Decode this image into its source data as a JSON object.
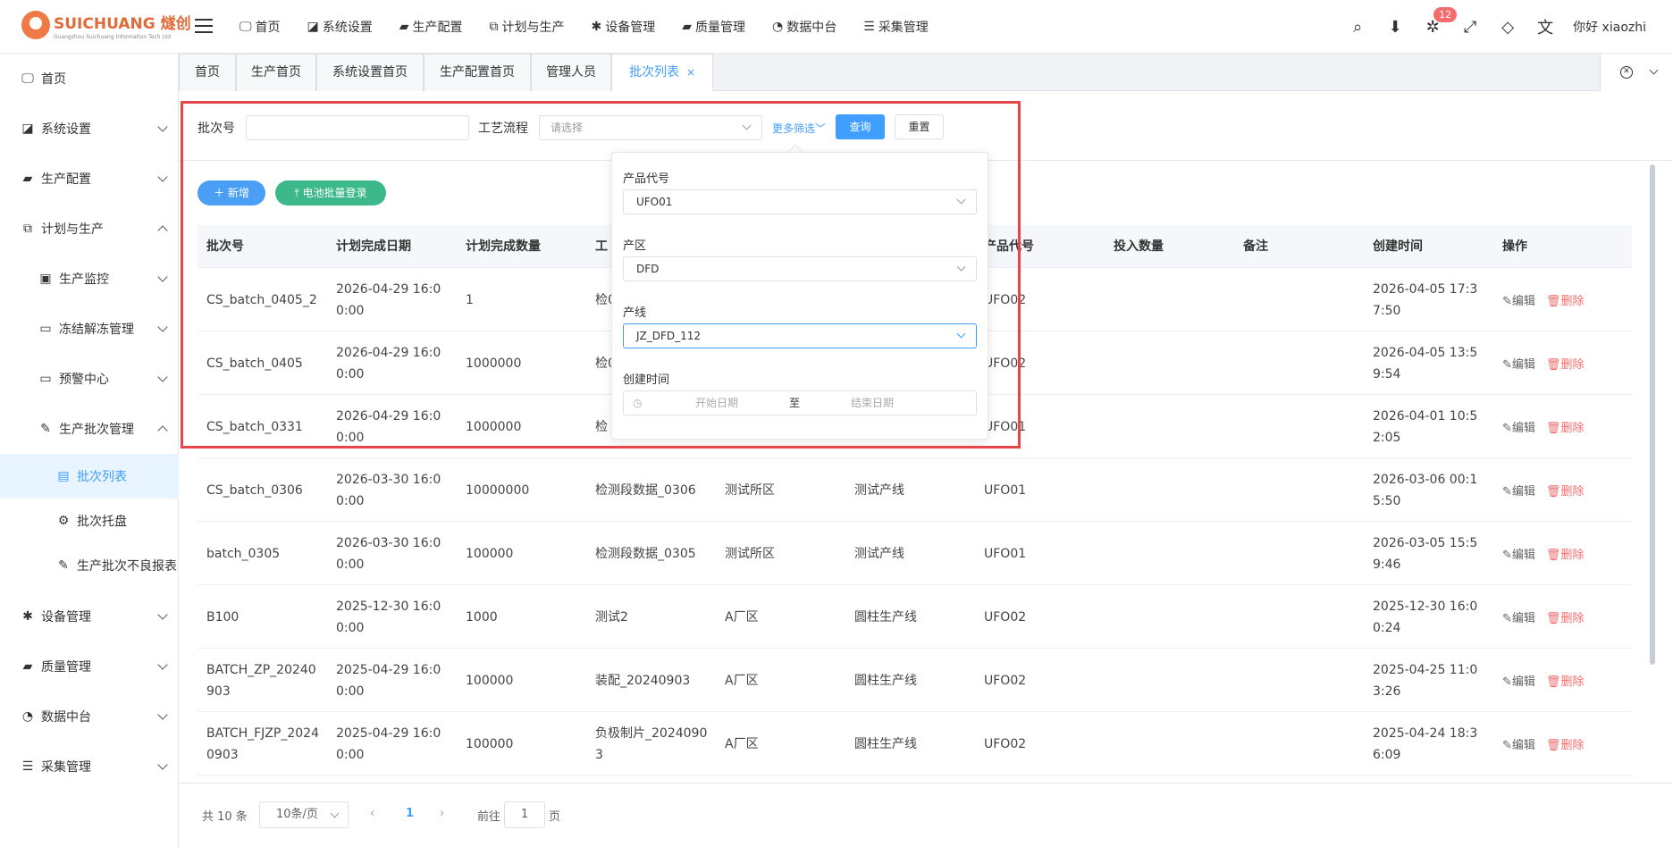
{
  "brand": {
    "logo_text": "SUICHUANG 燧创",
    "logo_sub": "Guangzhou Suichuang Information Tech Ltd"
  },
  "topnav": [
    {
      "icon": "monitor-icon",
      "glyph": "🖵",
      "label": "首页"
    },
    {
      "icon": "badge-icon",
      "glyph": "◪",
      "label": "系统设置"
    },
    {
      "icon": "briefcase-icon",
      "glyph": "▰",
      "label": "生产配置"
    },
    {
      "icon": "windows-icon",
      "glyph": "⧉",
      "label": "计划与生产"
    },
    {
      "icon": "asterisk-icon",
      "glyph": "✱",
      "label": "设备管理"
    },
    {
      "icon": "briefcase-icon",
      "glyph": "▰",
      "label": "质量管理"
    },
    {
      "icon": "pie-chart-icon",
      "glyph": "◔",
      "label": "数据中台"
    },
    {
      "icon": "database-icon",
      "glyph": "☰",
      "label": "采集管理"
    }
  ],
  "header_right": {
    "badge_count": "12",
    "greeting": "你好 xiaozhi"
  },
  "sidebar": [
    {
      "label": "首页",
      "glyph": "🖵",
      "level": 1,
      "arrow": "",
      "name": "sidebar-item-home"
    },
    {
      "label": "系统设置",
      "glyph": "◪",
      "level": 1,
      "arrow": "down",
      "name": "sidebar-item-system-settings"
    },
    {
      "label": "生产配置",
      "glyph": "▰",
      "level": 1,
      "arrow": "down",
      "name": "sidebar-item-production-config"
    },
    {
      "label": "计划与生产",
      "glyph": "⧉",
      "level": 1,
      "arrow": "up",
      "name": "sidebar-item-planning"
    },
    {
      "label": "生产监控",
      "glyph": "▣",
      "level": 2,
      "arrow": "down",
      "name": "sidebar-item-monitoring"
    },
    {
      "label": "冻结解冻管理",
      "glyph": "▭",
      "level": 2,
      "arrow": "down",
      "name": "sidebar-item-freeze"
    },
    {
      "label": "预警中心",
      "glyph": "▭",
      "level": 2,
      "arrow": "down",
      "name": "sidebar-item-warning"
    },
    {
      "label": "生产批次管理",
      "glyph": "✎",
      "level": 2,
      "arrow": "up",
      "name": "sidebar-item-batch-mgmt"
    },
    {
      "label": "批次列表",
      "glyph": "▤",
      "level": 3,
      "arrow": "",
      "name": "sidebar-item-batch-list",
      "active": true
    },
    {
      "label": "批次托盘",
      "glyph": "⚙",
      "level": 3,
      "arrow": "",
      "name": "sidebar-item-batch-tray"
    },
    {
      "label": "生产批次不良报表",
      "glyph": "✎",
      "level": 3,
      "arrow": "",
      "name": "sidebar-item-defect-report"
    },
    {
      "label": "设备管理",
      "glyph": "✱",
      "level": 1,
      "arrow": "down",
      "name": "sidebar-item-equipment"
    },
    {
      "label": "质量管理",
      "glyph": "▰",
      "level": 1,
      "arrow": "down",
      "name": "sidebar-item-quality"
    },
    {
      "label": "数据中台",
      "glyph": "◔",
      "level": 1,
      "arrow": "down",
      "name": "sidebar-item-data-center"
    },
    {
      "label": "采集管理",
      "glyph": "☰",
      "level": 1,
      "arrow": "down",
      "name": "sidebar-item-collection"
    }
  ],
  "tabs": [
    {
      "label": "首页"
    },
    {
      "label": "生产首页"
    },
    {
      "label": "系统设置首页"
    },
    {
      "label": "生产配置首页"
    },
    {
      "label": "管理人员"
    },
    {
      "label": "批次列表",
      "active": true,
      "close": "×"
    }
  ],
  "search": {
    "batch_label": "批次号",
    "batch_value": "",
    "process_label": "工艺流程",
    "process_placeholder": "请选择",
    "more_filters": "更多筛选",
    "query_btn": "查询",
    "reset_btn": "重置"
  },
  "actions": {
    "add_btn": "新增",
    "battery_btn": "电池批量登录"
  },
  "filter_popover": {
    "product_code_label": "产品代号",
    "product_code_value": "UFO01",
    "area_label": "产区",
    "area_value": "DFD",
    "line_label": "产线",
    "line_value": "JZ_DFD_112",
    "created_label": "创建时间",
    "start_placeholder": "开始日期",
    "range_sep": "至",
    "end_placeholder": "结束日期"
  },
  "table": {
    "columns": [
      "批次号",
      "计划完成日期",
      "计划完成数量",
      "工",
      "",
      "",
      "产品代号",
      "投入数量",
      "备注",
      "创建时间",
      "操作"
    ],
    "rows": [
      [
        "CS_batch_0405_2",
        "2026-04-29 16:00:00",
        "1",
        "检0",
        "",
        "",
        "UFO02",
        "",
        "",
        "2026-04-05 17:37:50"
      ],
      [
        "CS_batch_0405",
        "2026-04-29 16:00:00",
        "1000000",
        "检0",
        "",
        "",
        "UFO02",
        "",
        "",
        "2026-04-05 13:59:54"
      ],
      [
        "CS_batch_0331",
        "2026-04-29 16:00:00",
        "1000000",
        "检",
        "",
        "",
        "UFO01",
        "",
        "",
        "2026-04-01 10:52:05"
      ],
      [
        "CS_batch_0306",
        "2026-03-30 16:00:00",
        "10000000",
        "检测段数据_0306",
        "测试所区",
        "测试产线",
        "UFO01",
        "",
        "",
        "2026-03-06 00:15:50"
      ],
      [
        "batch_0305",
        "2026-03-30 16:00:00",
        "100000",
        "检测段数据_0305",
        "测试所区",
        "测试产线",
        "UFO01",
        "",
        "",
        "2026-03-05 15:59:46"
      ],
      [
        "B100",
        "2025-12-30 16:00:00",
        "1000",
        "测试2",
        "A厂区",
        "圆柱生产线",
        "UFO02",
        "",
        "",
        "2025-12-30 16:00:24"
      ],
      [
        "BATCH_ZP_20240903",
        "2025-04-29 16:00:00",
        "100000",
        "装配_20240903",
        "A厂区",
        "圆柱生产线",
        "UFO02",
        "",
        "",
        "2025-04-25 11:03:26"
      ],
      [
        "BATCH_FJZP_20240903",
        "2025-04-29 16:00:00",
        "100000",
        "负极制片_20240903",
        "A厂区",
        "圆柱生产线",
        "UFO02",
        "",
        "",
        "2025-04-24 18:36:09"
      ]
    ],
    "edit_label": "编辑",
    "delete_label": "删除"
  },
  "pagination": {
    "total": "共 10 条",
    "page_size": "10条/页",
    "current": "1",
    "goto_prefix": "前往",
    "goto_value": "1",
    "goto_suffix": "页"
  },
  "colors": {
    "primary": "#409eff",
    "success": "#3cb88a",
    "danger": "#f56c6c",
    "highlight": "#e8454b"
  }
}
